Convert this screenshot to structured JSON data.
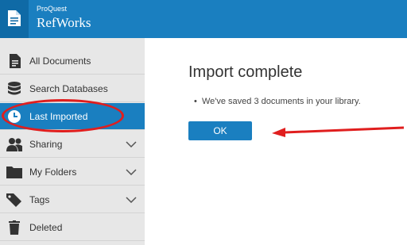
{
  "header": {
    "brand_small": "ProQuest",
    "brand_big": "RefWorks",
    "logo_icon": "document-icon",
    "color": "#1a7fc0"
  },
  "sidebar": {
    "items": [
      {
        "label": "All Documents",
        "icon": "document-icon"
      },
      {
        "label": "Search Databases",
        "icon": "database-icon"
      },
      {
        "label": "Last Imported",
        "icon": "clock-icon",
        "active": true
      },
      {
        "label": "Sharing",
        "icon": "people-icon",
        "expandable": true
      },
      {
        "label": "My Folders",
        "icon": "folder-icon",
        "expandable": true
      },
      {
        "label": "Tags",
        "icon": "tag-icon",
        "expandable": true
      },
      {
        "label": "Deleted",
        "icon": "trash-icon"
      }
    ]
  },
  "main": {
    "title": "Import complete",
    "message": "We've saved 3 documents in your library.",
    "ok_label": "OK"
  },
  "annotation": {
    "color": "#e01e1e"
  }
}
